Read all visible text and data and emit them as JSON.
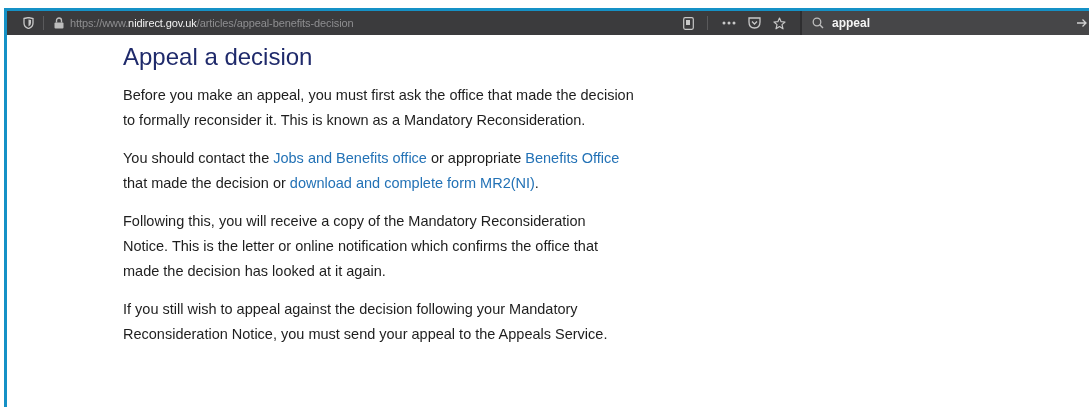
{
  "toolbar": {
    "url": {
      "scheme": "https://www.",
      "host": "nidirect.gov.uk",
      "path": "/articles/appeal-benefits-decision"
    },
    "search": {
      "value": "appeal"
    }
  },
  "article": {
    "title": "Appeal a decision",
    "paragraphs": [
      [
        [
          {
            "kind": "text",
            "text": "Before you make an appeal, you must first ask the office that made the decision"
          }
        ],
        [
          {
            "kind": "text",
            "text": "to formally reconsider it. This is known as a Mandatory Reconsideration."
          }
        ]
      ],
      [
        [
          {
            "kind": "text",
            "text": "You should contact the "
          },
          {
            "kind": "link",
            "text": "Jobs and Benefits office"
          },
          {
            "kind": "text",
            "text": " or appropriate "
          },
          {
            "kind": "link",
            "text": "Benefits Office"
          }
        ],
        [
          {
            "kind": "text",
            "text": "that made the decision or "
          },
          {
            "kind": "link",
            "text": "download and complete form MR2(NI)"
          },
          {
            "kind": "text",
            "text": "."
          }
        ]
      ],
      [
        [
          {
            "kind": "text",
            "text": "Following this, you will receive a copy of the Mandatory Reconsideration"
          }
        ],
        [
          {
            "kind": "text",
            "text": "Notice.  This is the letter or online notification which confirms the office that"
          }
        ],
        [
          {
            "kind": "text",
            "text": "made the decision has looked at it again."
          }
        ]
      ],
      [
        [
          {
            "kind": "text",
            "text": "If you still wish to appeal against the decision following your Mandatory"
          }
        ],
        [
          {
            "kind": "text",
            "text": "Reconsideration Notice, you must send your appeal to the Appeals Service."
          }
        ]
      ]
    ]
  }
}
